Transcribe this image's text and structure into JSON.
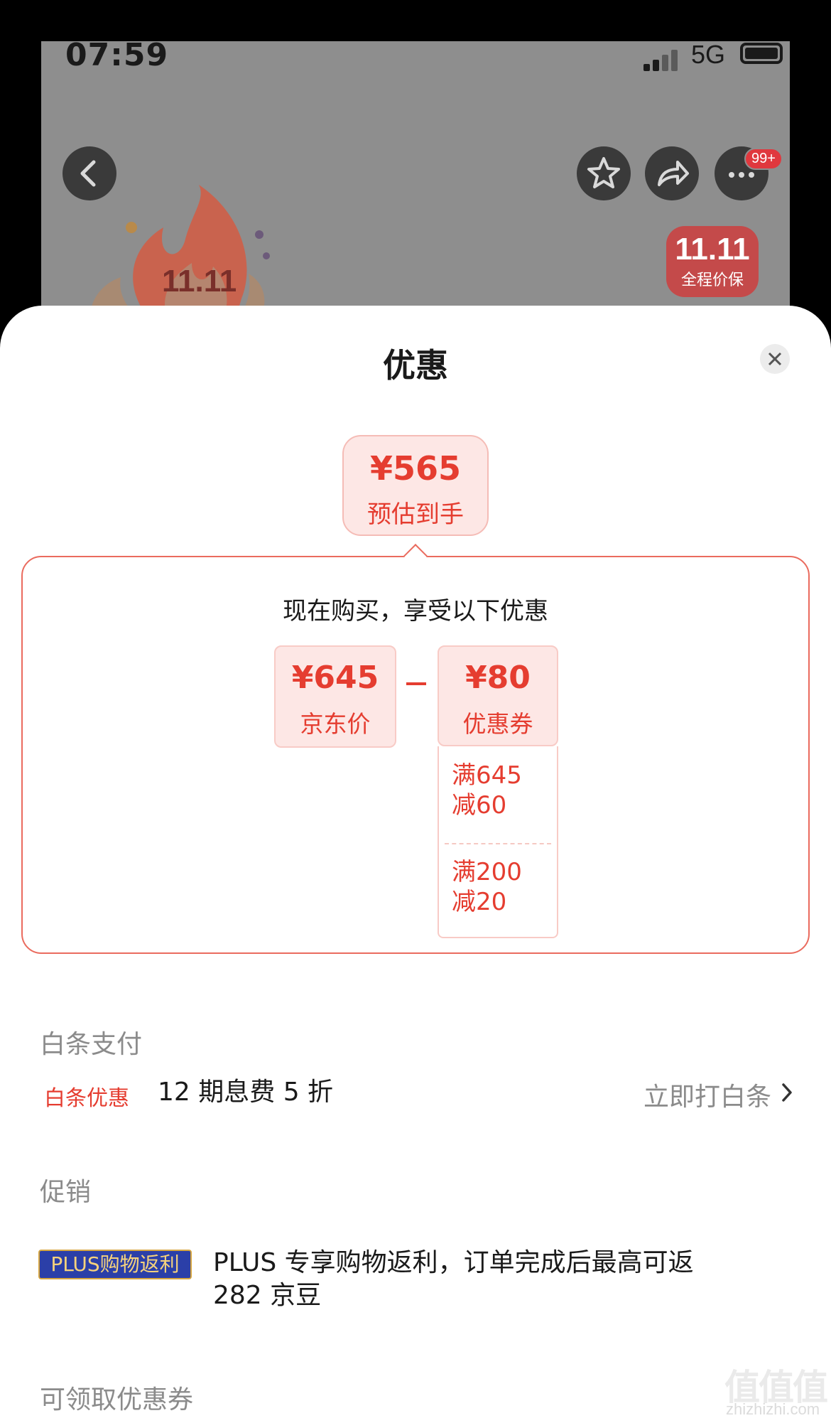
{
  "status_bar": {
    "time": "07:59",
    "network": "5G"
  },
  "background": {
    "notification_badge": "99+",
    "price_guard": {
      "logo_text": "11.11",
      "label": "全程价保"
    },
    "flame_logo_text": "11.11"
  },
  "sheet": {
    "title": "优惠",
    "estimate": {
      "price": "¥565",
      "label": "预估到手"
    },
    "deal": {
      "heading": "现在购买，享受以下优惠",
      "jd_price": {
        "price": "¥645",
        "label": "京东价"
      },
      "coupon": {
        "price": "¥80",
        "label": "优惠券"
      },
      "coupon_items": [
        "满645\n减60",
        "满200\n减20"
      ]
    },
    "baitiao": {
      "section": "白条支付",
      "tag": "白条优惠",
      "text": "12 期息费 5 折",
      "link": "立即打白条"
    },
    "promo": {
      "section": "促销",
      "tag": "PLUS购物返利",
      "text_line1": "PLUS 专享购物返利，订单完成后最高可返",
      "text_line2": "282 京豆"
    },
    "coupons_section": "可领取优惠券"
  },
  "watermark": {
    "glyphs": "值值值",
    "url": "zhizhizhi.com"
  },
  "colors": {
    "accent": "#e53d30",
    "pink_bg": "#fde7e5",
    "plus_blue": "#2b3fa8"
  }
}
